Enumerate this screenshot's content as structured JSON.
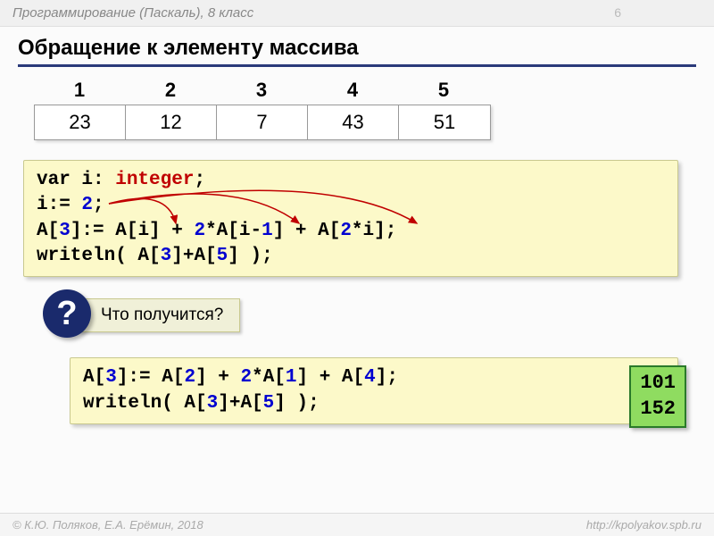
{
  "header": {
    "breadcrumb": "Программирование (Паскаль), 8 класс",
    "page_number": "6"
  },
  "title": "Обращение к элементу массива",
  "array": {
    "indices": [
      "1",
      "2",
      "3",
      "4",
      "5"
    ],
    "values": [
      "23",
      "12",
      "7",
      "43",
      "51"
    ]
  },
  "code1": {
    "l1a": "var i: ",
    "l1b": "integer",
    "l1c": ";",
    "l2a": "i:= ",
    "l2b": "2",
    "l2c": ";",
    "l3a": "A[",
    "l3b": "3",
    "l3c": "]:= A[i] + ",
    "l3d": "2",
    "l3e": "*A[i-",
    "l3f": "1",
    "l3g": "] + A[",
    "l3h": "2",
    "l3i": "*i];",
    "l4a": "writeln( A[",
    "l4b": "3",
    "l4c": "]+A[",
    "l4d": "5",
    "l4e": "] );"
  },
  "question": {
    "symbol": "?",
    "label": "Что получится?"
  },
  "code2": {
    "l1a": "A[",
    "l1b": "3",
    "l1c": "]:= A[",
    "l1d": "2",
    "l1e": "] + ",
    "l1f": "2",
    "l1g": "*A[",
    "l1h": "1",
    "l1i": "] + A[",
    "l1j": "4",
    "l1k": "];",
    "l2a": "writeln( A[",
    "l2b": "3",
    "l2c": "]+A[",
    "l2d": "5",
    "l2e": "] );"
  },
  "result": {
    "v1": "101",
    "v2": "152"
  },
  "footer": {
    "copyright": "© К.Ю. Поляков, Е.А. Ерёмин, 2018",
    "url": "http://kpolyakov.spb.ru"
  }
}
